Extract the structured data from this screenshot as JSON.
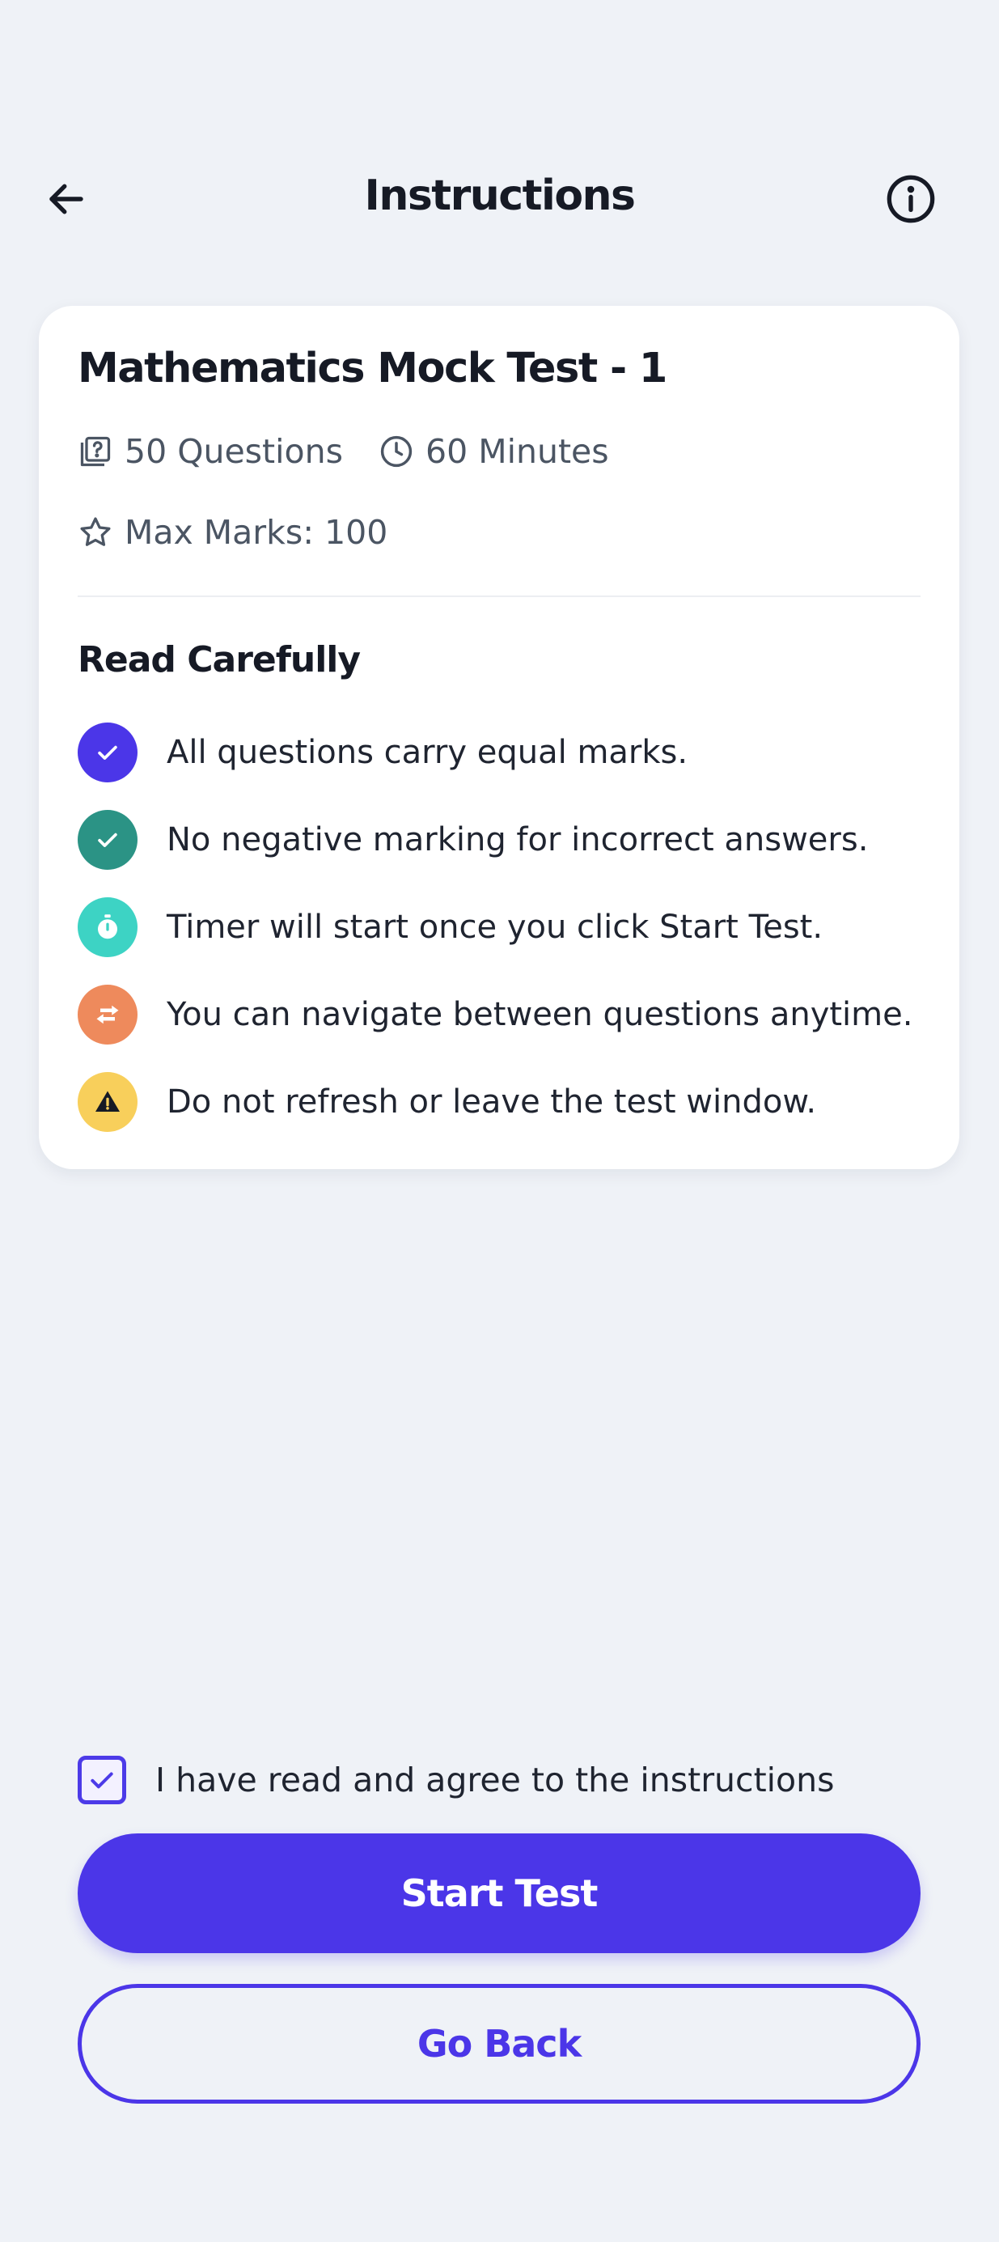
{
  "header": {
    "title": "Instructions",
    "back_icon": "arrow-left-icon",
    "info_icon": "info-circle-icon"
  },
  "test": {
    "title": "Mathematics Mock Test - 1",
    "questions": "50 Questions",
    "duration": "60 Minutes",
    "max_marks": "Max Marks: 100"
  },
  "instructions": {
    "heading": "Read Carefully",
    "items": [
      {
        "text": "All questions carry equal marks.",
        "icon": "check-icon",
        "color": "#4b36e8"
      },
      {
        "text": "No negative marking for incorrect answers.",
        "icon": "check-icon",
        "color": "#2b9385"
      },
      {
        "text": "Timer will start once you click Start Test.",
        "icon": "stopwatch-icon",
        "color": "#3dd3c4"
      },
      {
        "text": "You can navigate between questions anytime.",
        "icon": "swap-arrows-icon",
        "color": "#ee8a5c"
      },
      {
        "text": "Do not refresh or leave the test window.",
        "icon": "warning-icon",
        "color": "#f8cf5b"
      }
    ]
  },
  "agreement": {
    "label": "I have read and agree to the instructions",
    "checked": true
  },
  "actions": {
    "start_label": "Start Test",
    "back_label": "Go Back"
  },
  "colors": {
    "background": "#eff2f7",
    "primary": "#4b36e8",
    "card": "#ffffff"
  }
}
